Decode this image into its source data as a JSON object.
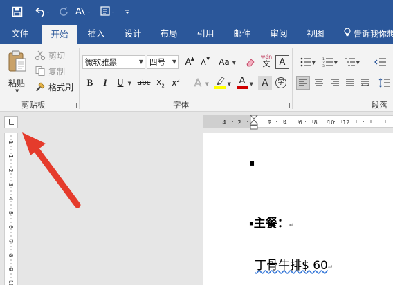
{
  "qat": {
    "undo_icon": "undo-icon",
    "redo_icon": "redo-icon",
    "save_icon": "save-icon",
    "format_icon": "text-format-icon",
    "touch_icon": "touch-mode-icon",
    "customize_icon": "customize-qat-icon"
  },
  "tabs": [
    {
      "label": "文件"
    },
    {
      "label": "开始"
    },
    {
      "label": "插入"
    },
    {
      "label": "设计"
    },
    {
      "label": "布局"
    },
    {
      "label": "引用"
    },
    {
      "label": "邮件"
    },
    {
      "label": "审阅"
    },
    {
      "label": "视图"
    }
  ],
  "tell_me": "告诉我你想",
  "clipboard": {
    "paste_label": "粘贴",
    "cut_label": "剪切",
    "copy_label": "复制",
    "format_painter_label": "格式刷",
    "group_label": "剪贴板"
  },
  "font": {
    "font_name": "微软雅黑",
    "font_size": "四号",
    "grow": "A",
    "shrink": "A",
    "change_case": "Aa",
    "phonetic_top": "wén",
    "phonetic_bottom": "文",
    "border_char": "A",
    "bold": "B",
    "italic": "I",
    "underline": "U",
    "strike": "abc",
    "sub": "x",
    "sup": "x",
    "sub_mark": "2",
    "sup_mark": "2",
    "effects": "A",
    "highlight": "ab",
    "font_color": "A",
    "shade": "A",
    "enclose": "字",
    "group_label": "字体"
  },
  "paragraph": {
    "group_label": "段落"
  },
  "ruler": {
    "h_ticks": [
      "4",
      "2",
      "2",
      "4",
      "6",
      "8",
      "10",
      "12"
    ],
    "v_ticks": [
      "1",
      "1",
      "2",
      "3",
      "4",
      "5",
      "6",
      "7",
      "8",
      "9",
      "10"
    ]
  },
  "document": {
    "line1_bullet": "▪",
    "heading": "主餐：",
    "item": "丁骨牛排$ 60",
    "pilcrow": "↵"
  },
  "colors": {
    "ribbon_blue": "#2b579a",
    "highlight_yellow": "#ffff00",
    "font_red": "#d00000",
    "arrow_red": "#e53b2c"
  }
}
